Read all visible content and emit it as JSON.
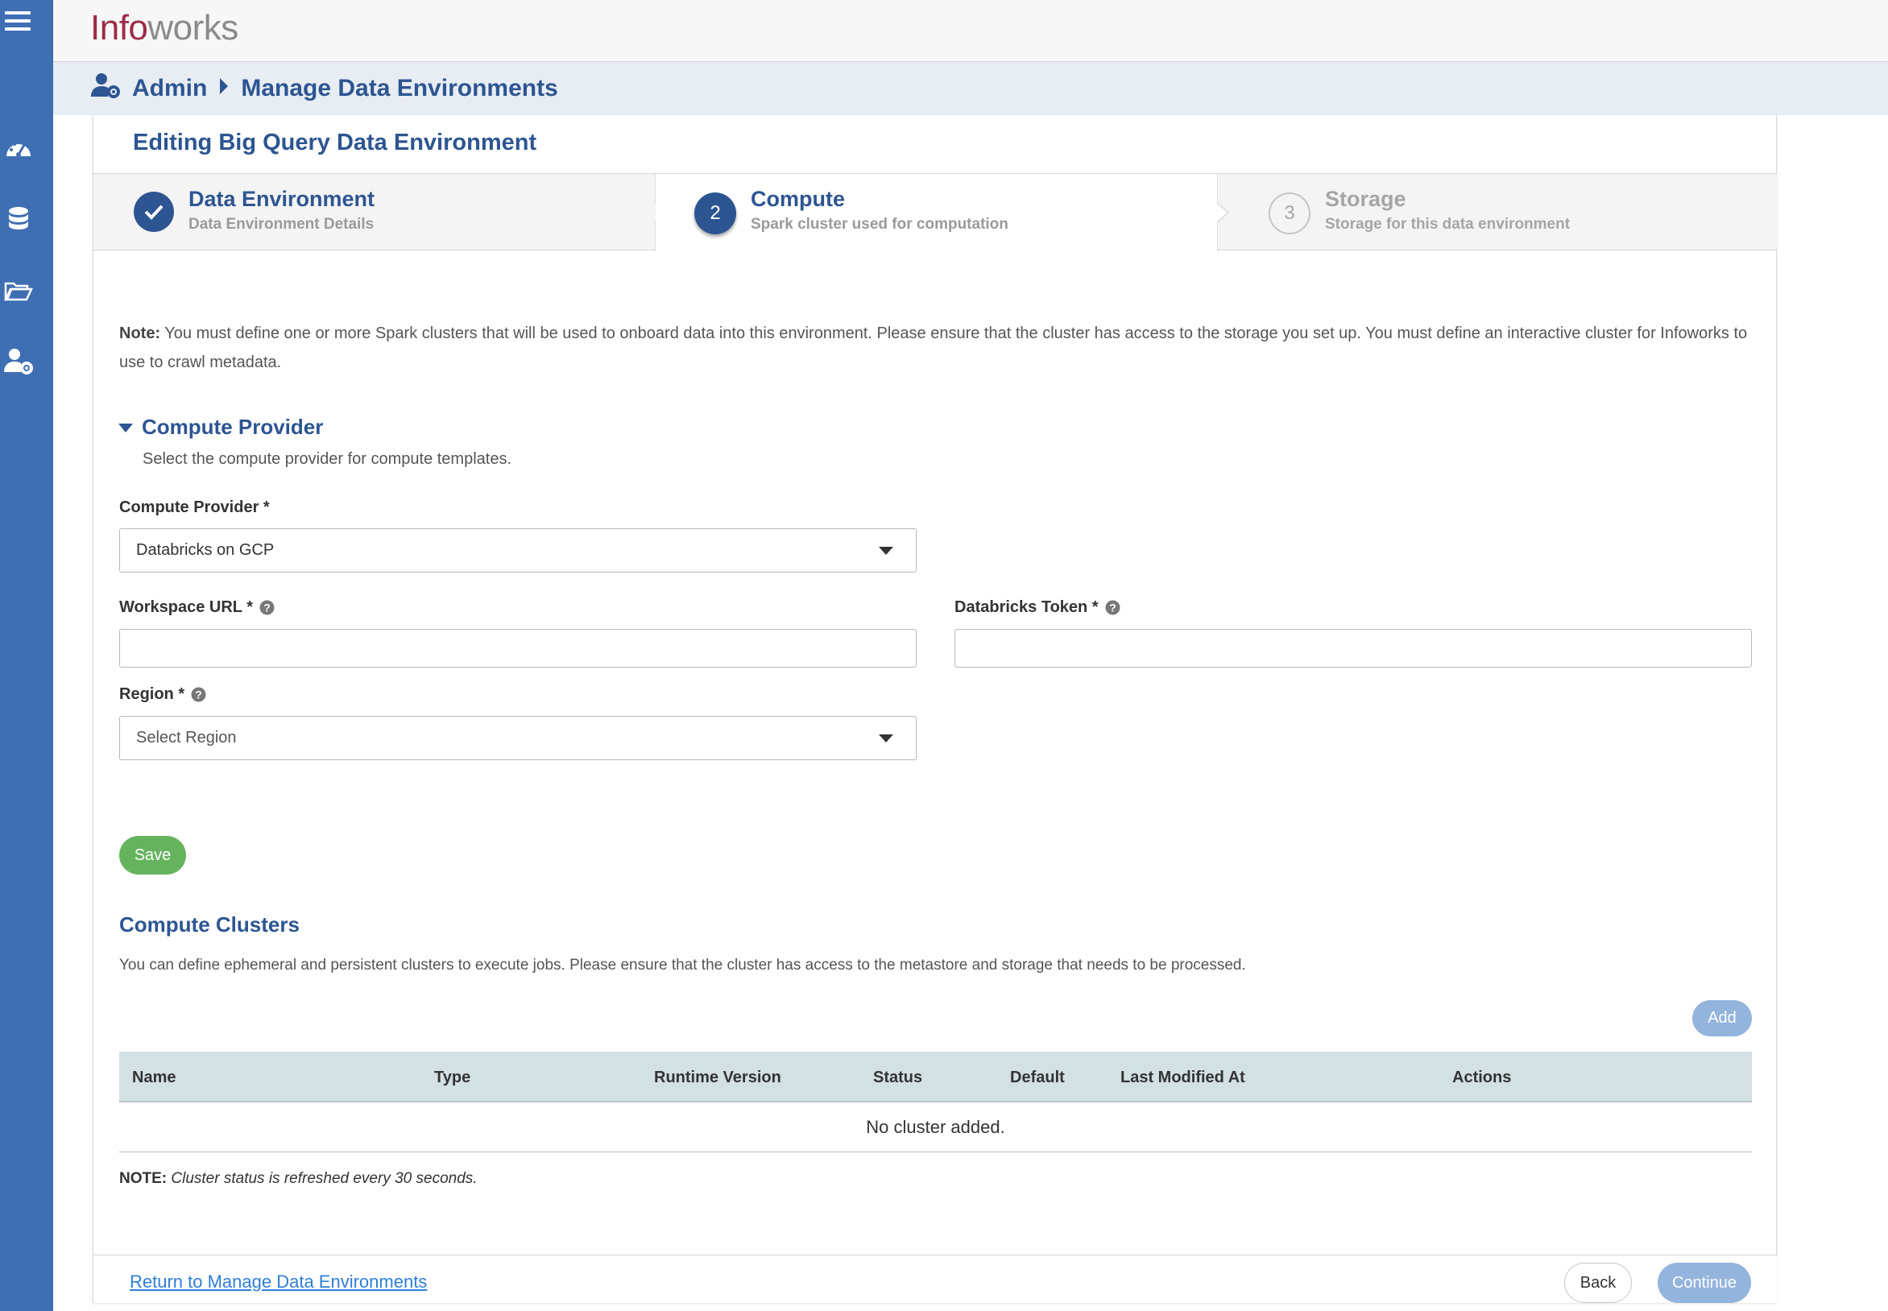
{
  "app": {
    "logo_mark": "Info",
    "logo_rest": "works"
  },
  "breadcrumb": {
    "root": "Admin",
    "current": "Manage Data Environments"
  },
  "panel": {
    "title": "Editing Big Query Data Environment"
  },
  "steps": [
    {
      "number": "1",
      "title": "Data Environment",
      "subtitle": "Data Environment Details",
      "state": "complete"
    },
    {
      "number": "2",
      "title": "Compute",
      "subtitle": "Spark cluster used for computation",
      "state": "active"
    },
    {
      "number": "3",
      "title": "Storage",
      "subtitle": "Storage for this data environment",
      "state": "pending"
    }
  ],
  "note": {
    "label": "Note:",
    "text": " You must define one or more Spark clusters that will be used to onboard data into this environment. Please ensure that the cluster has access to the storage you set up. You must define an interactive cluster for Infoworks to use to crawl metadata."
  },
  "compute_provider_section": {
    "title": "Compute Provider",
    "subtitle": "Select the compute provider for compute templates."
  },
  "form": {
    "compute_provider_label": "Compute Provider *",
    "compute_provider_value": "Databricks on GCP",
    "workspace_url_label": "Workspace URL *",
    "workspace_url_value": "",
    "databricks_token_label": "Databricks Token *",
    "databricks_token_value": "",
    "region_label": "Region *",
    "region_placeholder": "Select Region",
    "save_label": "Save"
  },
  "clusters": {
    "title": "Compute Clusters",
    "subtitle": "You can define ephemeral and persistent clusters to execute jobs. Please ensure that the cluster has access to the metastore and storage that needs to be processed.",
    "add_label": "Add",
    "columns": [
      "Name",
      "Type",
      "Runtime Version",
      "Status",
      "Default",
      "Last Modified At",
      "Actions"
    ],
    "empty_text": "No cluster added.",
    "note_label": "NOTE:",
    "note_text": "Cluster status is refreshed every 30 seconds."
  },
  "footer": {
    "return_link": "Return to Manage Data Environments",
    "back_label": "Back",
    "continue_label": "Continue"
  },
  "colors": {
    "sidebar": "#3f6fb3",
    "primary_text": "#2d5592",
    "save_green": "#66b35e",
    "disabled_blue": "#93b4dc",
    "logo_red": "#9c2b47"
  }
}
